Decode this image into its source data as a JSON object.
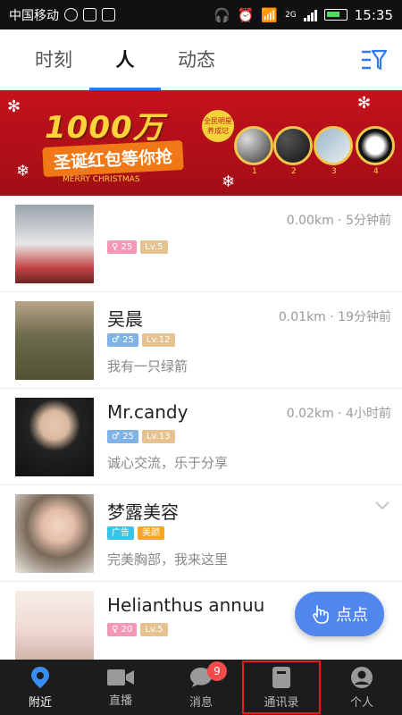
{
  "status_bar": {
    "carrier": "中国移动",
    "network": "2G",
    "time": "15:35"
  },
  "tabs": [
    {
      "label": "时刻",
      "active": false
    },
    {
      "label": "人",
      "active": true
    },
    {
      "label": "动态",
      "active": false
    }
  ],
  "banner": {
    "title": "1000万",
    "subtitle": "圣诞红包等你抢",
    "merry": "MERRY CHRISTMAS",
    "badge": "全民明星养成记",
    "ornament_labels": [
      "1",
      "2",
      "3",
      "4"
    ]
  },
  "people": [
    {
      "name": "",
      "distance": "0.00km",
      "time": "5分钟前",
      "gender": "female",
      "age": "25",
      "level": "Lv.5",
      "bio": ""
    },
    {
      "name": "吴晨",
      "distance": "0.01km",
      "time": "19分钟前",
      "gender": "male",
      "age": "25",
      "level": "Lv.12",
      "bio": "我有一只绿箭"
    },
    {
      "name": "Mr.candy",
      "distance": "0.02km",
      "time": "4小时前",
      "gender": "male",
      "age": "25",
      "level": "Lv.13",
      "bio": "诚心交流，乐于分享"
    },
    {
      "name": "梦露美容",
      "tag1": "广告",
      "tag2": "美颜",
      "bio": "完美胸部，我来这里"
    },
    {
      "name": "Helianthus annuu",
      "gender": "female",
      "age": "20",
      "level": "Lv.5"
    }
  ],
  "float_button": {
    "label": "点点"
  },
  "bottom_nav": [
    {
      "label": "附近",
      "icon": "location-pin-icon",
      "active": true
    },
    {
      "label": "直播",
      "icon": "video-camera-icon",
      "active": false
    },
    {
      "label": "消息",
      "icon": "chat-bubble-icon",
      "badge": "9",
      "active": false
    },
    {
      "label": "通讯录",
      "icon": "contacts-book-icon",
      "active": false,
      "highlighted": true
    },
    {
      "label": "个人",
      "icon": "user-icon",
      "active": false
    }
  ],
  "colors": {
    "accent": "#2d7bf0",
    "float": "#4f87ee",
    "nav_bg": "#1c1c1c",
    "highlight": "#e21f1f"
  }
}
